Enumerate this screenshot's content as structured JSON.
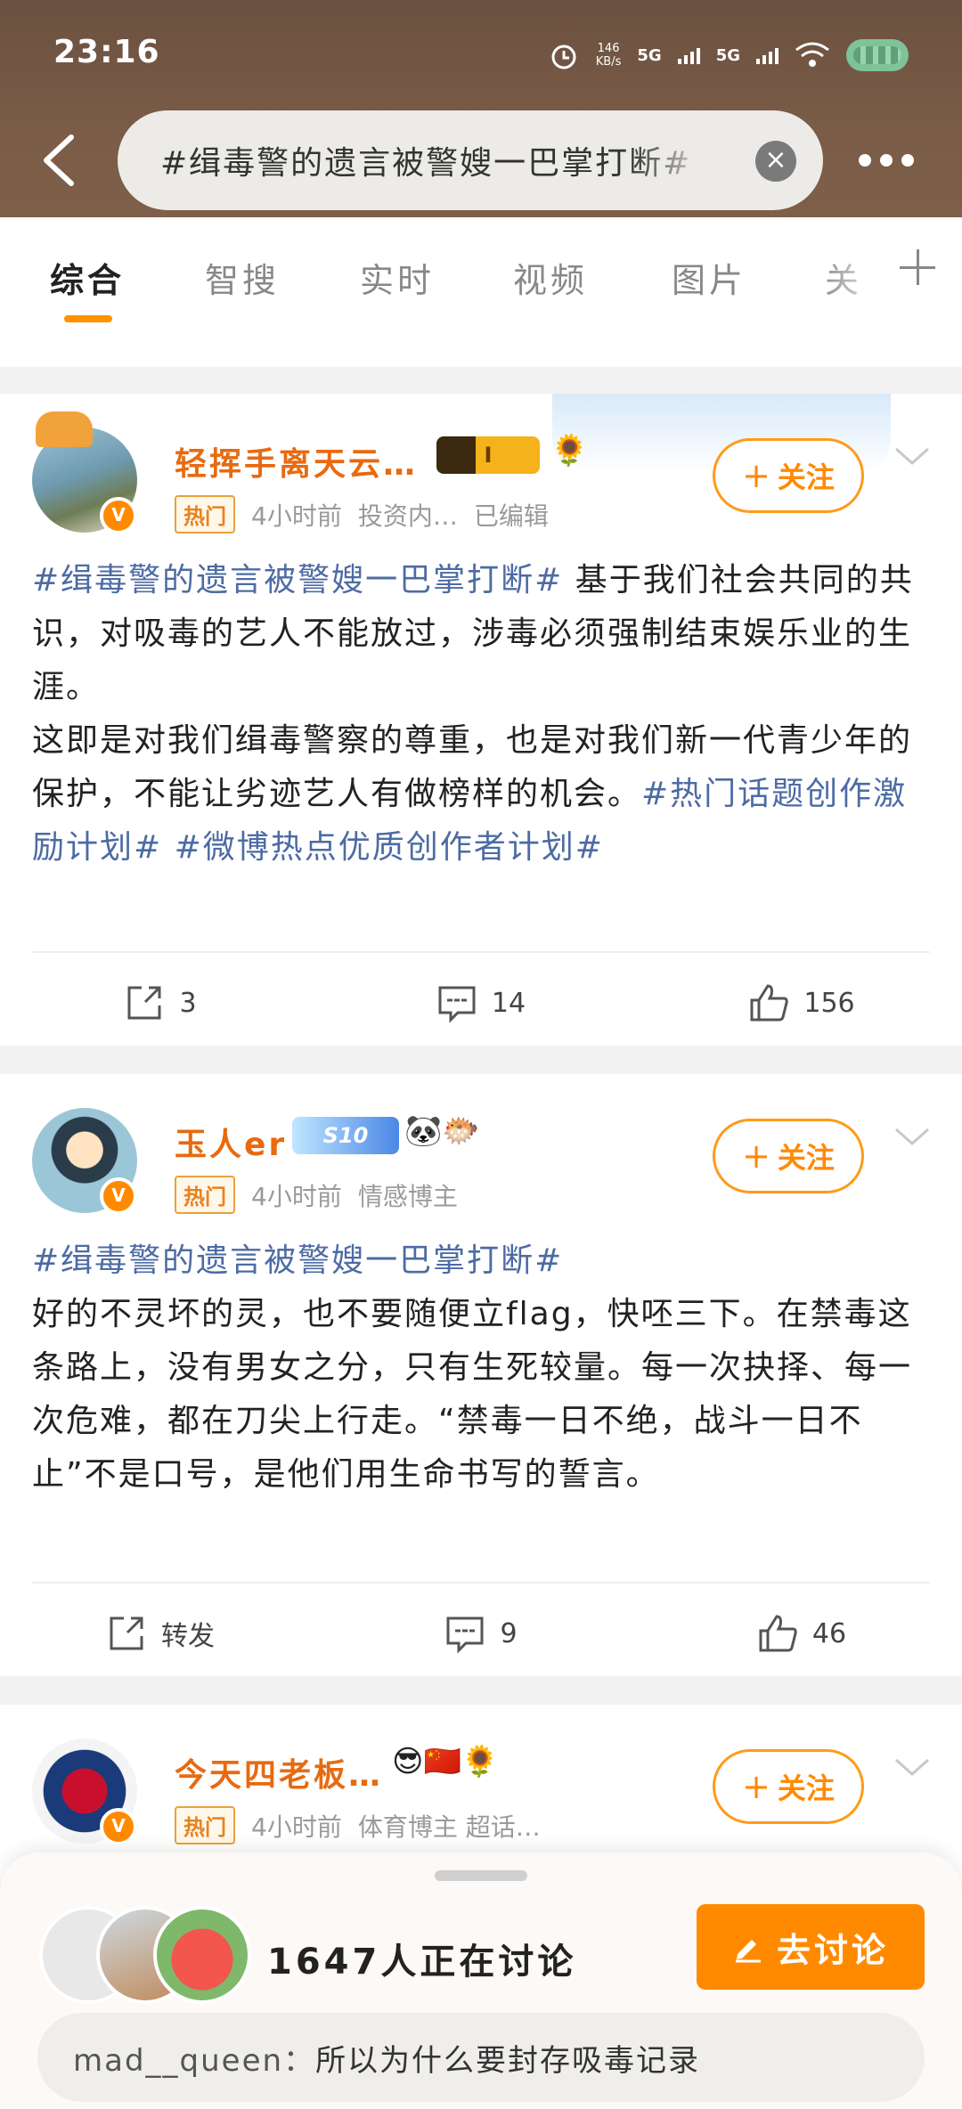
{
  "status_bar": {
    "time": "23:16",
    "net_speed": "146",
    "net_unit": "KB/s",
    "sig1": "5G",
    "sig2": "5G"
  },
  "search": {
    "query": "#缉毒警的遗言被警嫂一巴掌打断#",
    "clear_icon": "close-icon"
  },
  "tabs": [
    "综合",
    "智搜",
    "实时",
    "视频",
    "图片",
    "关"
  ],
  "colors": {
    "accent": "#ff8a00",
    "topic": "#4d6ba3",
    "username": "#e86a10"
  },
  "posts": [
    {
      "username": "轻挥手离天云…",
      "level_badge": "I",
      "emoji": "🌻",
      "hot_tag": "热门",
      "time": "4小时前",
      "source": "投资内…",
      "extra": "已编辑",
      "follow_label": "关注",
      "topic_main": "#缉毒警的遗言被警嫂一巴掌打断#",
      "text_1": "基于我们社会共同的共识，对吸毒的艺人不能放过，涉毒必须强制结束娱乐业的生涯。",
      "text_2": "这即是对我们缉毒警察的尊重，也是对我们新一代青少年的保护，不能让劣迹艺人有做榜样的机会。",
      "topic_2": "#热门话题创作激励计划#",
      "topic_3": "#微博热点优质创作者计划#",
      "reposts": "3",
      "comments": "14",
      "likes": "156"
    },
    {
      "username": "玉人er",
      "level_badge": "S10",
      "emoji": "🐼🐡",
      "hot_tag": "热门",
      "time": "4小时前",
      "source": "情感博主",
      "follow_label": "关注",
      "topic_main": "#缉毒警的遗言被警嫂一巴掌打断#",
      "text_1": "好的不灵坏的灵，也不要随便立flag，快呸三下。在禁毒这条路上，没有男女之分，只有生死较量。每一次抉择、每一次危难，都在刀尖上行走。“禁毒一日不绝，战斗一日不止”不是口号，是他们用生命书写的誓言。",
      "reposts": "转发",
      "comments": "9",
      "likes": "46"
    },
    {
      "username": "今天四老板…",
      "emoji": "😎🇨🇳🌻",
      "hot_tag": "热门",
      "time": "4小时前",
      "source": "体育博主 超话…",
      "follow_label": "关注"
    }
  ],
  "discussion": {
    "count_text": "1647人正在讨论",
    "button_label": "去讨论",
    "comment_nick": "mad__queen：",
    "comment_text": "所以为什么要封存吸毒记录"
  }
}
